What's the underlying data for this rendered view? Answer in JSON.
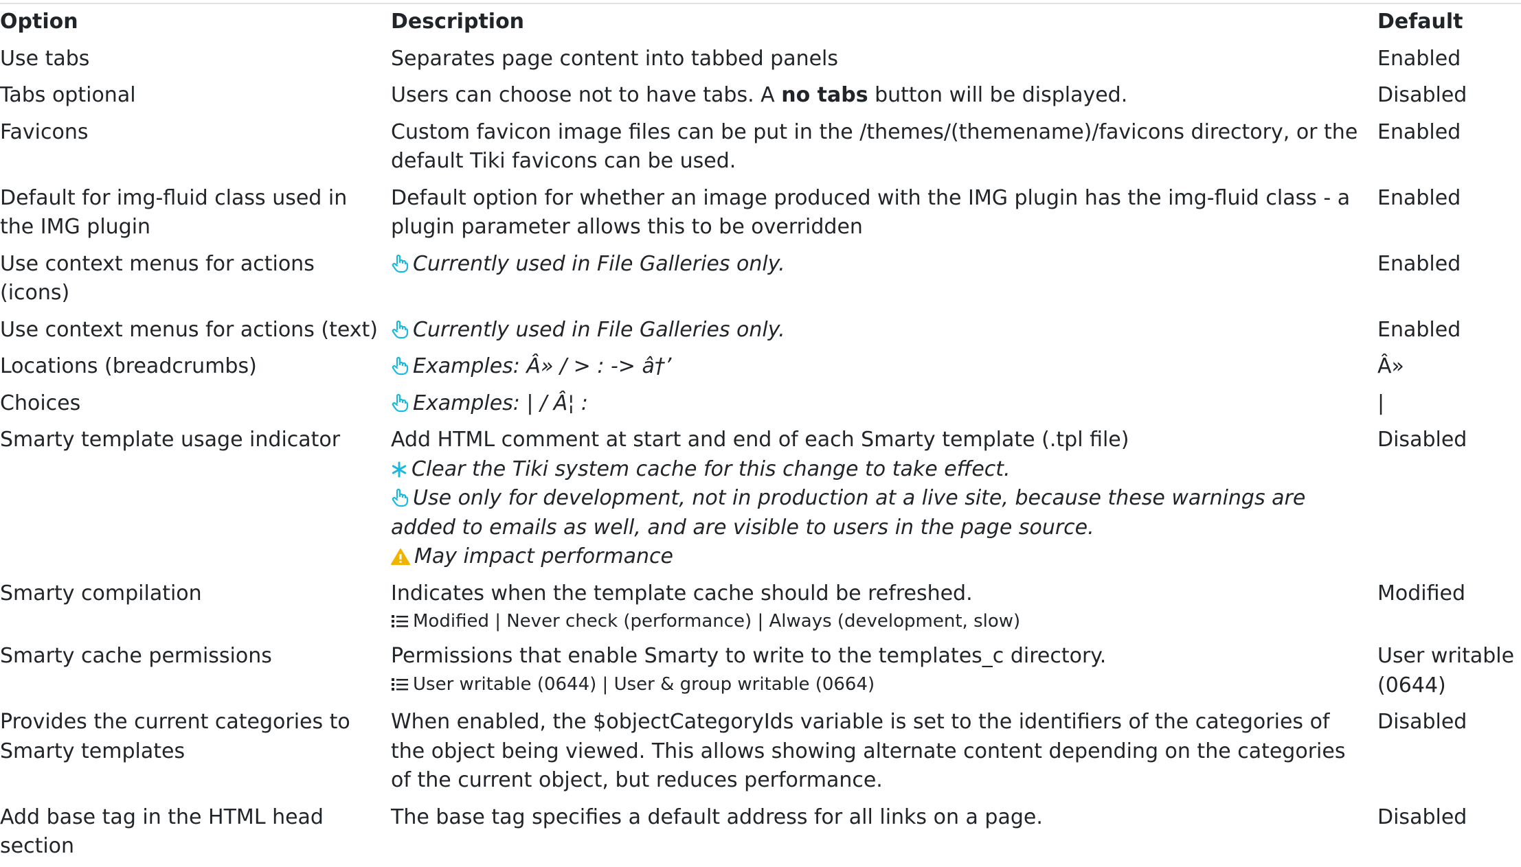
{
  "header": {
    "option": "Option",
    "description": "Description",
    "default": "Default"
  },
  "icons": {
    "hand": "pointing-hand-icon",
    "asterisk": "asterisk-icon",
    "warning": "warning-icon",
    "list": "list-icon"
  },
  "colors": {
    "info_icon": "#1ab8e0",
    "warning_icon": "#f0b400",
    "text": "#212529",
    "border": "#dee2e6"
  },
  "rows": [
    {
      "option": "Use tabs",
      "description": "Separates page content into tabbed panels",
      "default": "Enabled"
    },
    {
      "option": "Tabs optional",
      "description_pre": "Users can choose not to have tabs. A ",
      "description_bold": "no tabs",
      "description_post": " button will be displayed.",
      "default": "Disabled"
    },
    {
      "option": "Favicons",
      "description": "Custom favicon image files can be put in the /themes/(themename)/favicons directory, or the default Tiki favicons can be used.",
      "default": "Enabled"
    },
    {
      "option": "Default for img-fluid class used in the IMG plugin",
      "description": "Default option for whether an image produced with the IMG plugin has the img-fluid class - a plugin parameter allows this to be overridden",
      "default": "Enabled"
    },
    {
      "option": "Use context menus for actions (icons)",
      "hint": "Currently used in File Galleries only.",
      "default": "Enabled"
    },
    {
      "option": "Use context menus for actions (text)",
      "hint": "Currently used in File Galleries only.",
      "default": "Enabled"
    },
    {
      "option": "Locations (breadcrumbs)",
      "hint": "Examples: Â» / > : -> â†’",
      "default": "Â»"
    },
    {
      "option": "Choices",
      "hint": "Examples: | / Â¦ :",
      "default": "|"
    },
    {
      "option": "Smarty template usage indicator",
      "description": "Add HTML comment at start and end of each Smarty template (.tpl file)",
      "note_cache": "Clear the Tiki system cache for this change to take effect.",
      "hint": "Use only for development, not in production at a live site, because these warnings are added to emails as well, and are visible to users in the page source.",
      "warning": "May impact performance",
      "default": "Disabled"
    },
    {
      "option": "Smarty compilation",
      "description": "Indicates when the template cache should be refreshed.",
      "choices": "Modified | Never check (performance) | Always (development, slow)",
      "default": "Modified"
    },
    {
      "option": "Smarty cache permissions",
      "description": "Permissions that enable Smarty to write to the templates_c directory.",
      "choices": "User writable (0644) | User & group writable (0664)",
      "default": "User writable (0644)"
    },
    {
      "option": "Provides the current categories to Smarty templates",
      "description": "When enabled, the $objectCategoryIds variable is set to the identifiers of the categories of the object being viewed. This allows showing alternate content depending on the categories of the current object, but reduces performance.",
      "default": "Disabled"
    },
    {
      "option": "Add base tag in the HTML head section",
      "description": "The base tag specifies a default address for all links on a page.",
      "default": "Disabled"
    }
  ]
}
